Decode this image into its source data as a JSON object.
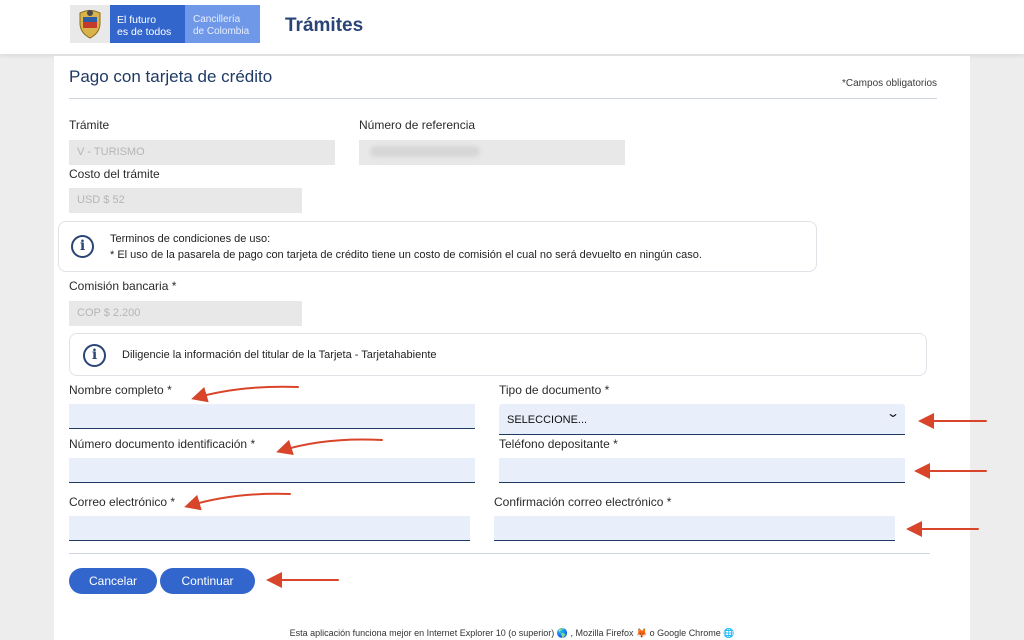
{
  "header": {
    "logo_line1": "El futuro",
    "logo_line2": "es de todos",
    "brand_line1": "Cancillería",
    "brand_line2": "de Colombia",
    "title": "Trámites"
  },
  "page": {
    "title": "Pago con tarjeta de crédito",
    "required_note": "*Campos obligatorios"
  },
  "summary": {
    "tramite_label": "Trámite",
    "tramite_value": "V - TURISMO",
    "referencia_label": "Número de referencia",
    "costo_label": "Costo del trámite",
    "costo_value": "USD  $ 52",
    "comision_label": "Comisión bancaria",
    "comision_value": "COP  $ 2.200"
  },
  "terms": {
    "title": "Terminos de condiciones de uso:",
    "text": "* El uso de la pasarela de pago con tarjeta de crédito tiene un costo de comisión el cual no será devuelto en ningún caso."
  },
  "holder_notice": "Diligencie la información del titular de la Tarjeta - Tarjetahabiente",
  "form": {
    "required_mark": "*",
    "nombre_label": "Nombre completo",
    "tipo_doc_label": "Tipo de documento",
    "tipo_doc_selected": "SELECCIONE...",
    "numero_doc_label": "Número documento identificación",
    "telefono_label": "Teléfono depositante",
    "correo_label": "Correo electrónico",
    "confirm_correo_label": "Confirmación correo electrónico"
  },
  "buttons": {
    "cancel": "Cancelar",
    "continue": "Continuar"
  },
  "footer": "Esta aplicación funciona mejor en Internet Explorer 10 (o superior) 🌎 , Mozilla Firefox 🦊 o Google Chrome 🌐",
  "colors": {
    "primary": "#3366cc",
    "navy": "#1f3a63",
    "input_bg": "#e9eefb",
    "arrow": "#d9452b"
  }
}
